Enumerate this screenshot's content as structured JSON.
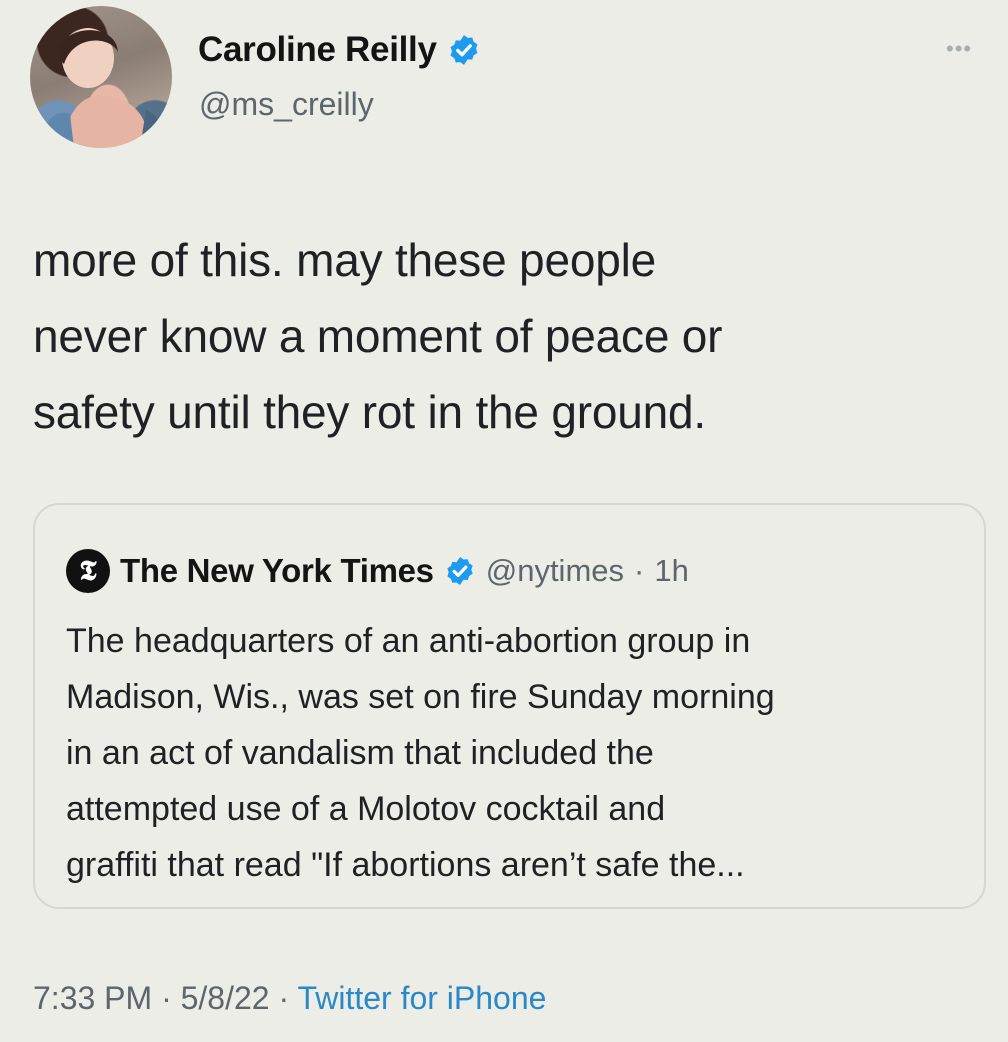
{
  "author": {
    "display_name": "Caroline Reilly",
    "handle": "@ms_creilly",
    "verified_icon": "verified-badge-icon",
    "avatar": "profile-photo"
  },
  "more_icon": "•••",
  "tweet": {
    "lines": [
      "more of this. may these people",
      "never know a moment of peace or",
      "safety until they rot in the ground."
    ]
  },
  "quote": {
    "logo_glyph": "𝕿",
    "display_name": "The New York Times",
    "handle": "@nytimes",
    "separator": "·",
    "age": "1h",
    "lines": [
      "The headquarters of an anti-abortion group in",
      "Madison, Wis., was set on fire Sunday morning",
      "in an act of vandalism that included the",
      "attempted use of a Molotov cocktail and",
      "graffiti that read \"If abortions aren’t safe the..."
    ]
  },
  "footer": {
    "time": "7:33 PM",
    "separator": "·",
    "date": "5/8/22",
    "source": "Twitter for iPhone"
  },
  "colors": {
    "background": "#ebede6",
    "verified_blue": "#1d9bf0",
    "link_blue": "#2a88c9",
    "secondary_text": "#5d656d"
  }
}
